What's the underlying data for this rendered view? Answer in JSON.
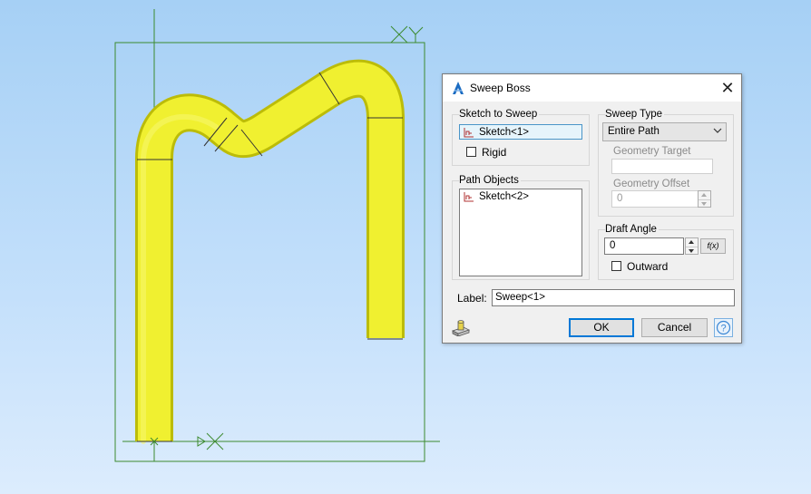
{
  "dialog": {
    "title": "Sweep Boss",
    "close_glyph": "✕",
    "sketch_to_sweep": {
      "label": "Sketch to Sweep",
      "selected_item": "Sketch<1>",
      "rigid_label": "Rigid",
      "rigid_checked": false
    },
    "path_objects": {
      "label": "Path Objects",
      "items": [
        "Sketch<2>"
      ]
    },
    "sweep_type": {
      "label": "Sweep Type",
      "selected": "Entire Path",
      "geometry_target_label": "Geometry Target",
      "geometry_target_value": "",
      "geometry_offset_label": "Geometry Offset",
      "geometry_offset_value": "0"
    },
    "draft_angle": {
      "label": "Draft Angle",
      "value": "0",
      "fx_label": "f(x)",
      "outward_label": "Outward",
      "outward_checked": false
    },
    "label_field": {
      "label": "Label:",
      "value": "Sweep<1>"
    },
    "buttons": {
      "ok": "OK",
      "cancel": "Cancel",
      "help": "?"
    }
  },
  "colors": {
    "pipe": "#f2f230",
    "sketch_lines": "#3c8a2e",
    "viewport_top": "#a6d0f5",
    "viewport_bottom": "#dcecfd",
    "accent": "#0078d7"
  },
  "icons": {
    "title": "sweep-boss-icon",
    "sketch_item": "sketch-icon",
    "preview": "preview-icon"
  }
}
